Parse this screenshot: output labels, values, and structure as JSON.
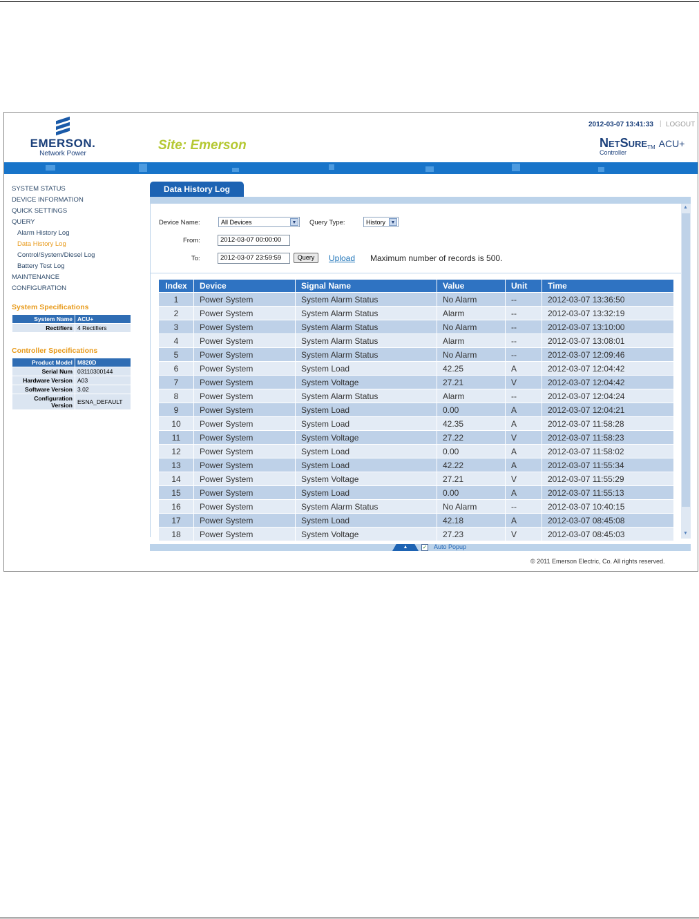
{
  "header": {
    "logo_name": "EMERSON.",
    "logo_sub": "Network Power",
    "site_title": "Site: Emerson",
    "datetime": "2012-03-07 13:41:33",
    "separator": "|",
    "logout": "LOGOUT",
    "brand_name": "NetSure",
    "brand_tm": "TM",
    "brand_product": "ACU+",
    "brand_sub": "Controller"
  },
  "nav": {
    "items": [
      {
        "label": "SYSTEM STATUS"
      },
      {
        "label": "DEVICE INFORMATION"
      },
      {
        "label": "QUICK SETTINGS"
      },
      {
        "label": "QUERY"
      },
      {
        "label": "Alarm History Log"
      },
      {
        "label": "Data History Log"
      },
      {
        "label": "Control/System/Diesel Log"
      },
      {
        "label": "Battery Test Log"
      },
      {
        "label": "MAINTENANCE"
      },
      {
        "label": "CONFIGURATION"
      }
    ]
  },
  "system_specs": {
    "title": "System Specifications",
    "rows": [
      {
        "key": "System Name",
        "value": "ACU+"
      },
      {
        "key": "Rectifiers",
        "value": "4 Rectifiers"
      }
    ]
  },
  "controller_specs": {
    "title": "Controller Specifications",
    "rows": [
      {
        "key": "Product Model",
        "value": "M820D"
      },
      {
        "key": "Serial Num",
        "value": "03110300144"
      },
      {
        "key": "Hardware Version",
        "value": "A03"
      },
      {
        "key": "Software Version",
        "value": "3.02"
      },
      {
        "key": "Configuration Version",
        "value": "ESNA_DEFAULT"
      }
    ]
  },
  "tab": {
    "label": "Data History Log"
  },
  "query": {
    "device_name_label": "Device Name:",
    "device_name_value": "All Devices",
    "query_type_label": "Query Type:",
    "query_type_value": "History",
    "from_label": "From:",
    "from_value": "2012-03-07 00:00:00",
    "to_label": "To:",
    "to_value": "2012-03-07 23:59:59",
    "query_button": "Query",
    "upload_link": "Upload",
    "max_records": "Maximum number of records is 500."
  },
  "table": {
    "headers": [
      "Index",
      "Device",
      "Signal Name",
      "Value",
      "Unit",
      "Time"
    ],
    "rows": [
      [
        "1",
        "Power System",
        "System Alarm Status",
        "No Alarm",
        "--",
        "2012-03-07 13:36:50"
      ],
      [
        "2",
        "Power System",
        "System Alarm Status",
        "Alarm",
        "--",
        "2012-03-07 13:32:19"
      ],
      [
        "3",
        "Power System",
        "System Alarm Status",
        "No Alarm",
        "--",
        "2012-03-07 13:10:00"
      ],
      [
        "4",
        "Power System",
        "System Alarm Status",
        "Alarm",
        "--",
        "2012-03-07 13:08:01"
      ],
      [
        "5",
        "Power System",
        "System Alarm Status",
        "No Alarm",
        "--",
        "2012-03-07 12:09:46"
      ],
      [
        "6",
        "Power System",
        "System Load",
        "42.25",
        "A",
        "2012-03-07 12:04:42"
      ],
      [
        "7",
        "Power System",
        "System Voltage",
        "27.21",
        "V",
        "2012-03-07 12:04:42"
      ],
      [
        "8",
        "Power System",
        "System Alarm Status",
        "Alarm",
        "--",
        "2012-03-07 12:04:24"
      ],
      [
        "9",
        "Power System",
        "System Load",
        "0.00",
        "A",
        "2012-03-07 12:04:21"
      ],
      [
        "10",
        "Power System",
        "System Load",
        "42.35",
        "A",
        "2012-03-07 11:58:28"
      ],
      [
        "11",
        "Power System",
        "System Voltage",
        "27.22",
        "V",
        "2012-03-07 11:58:23"
      ],
      [
        "12",
        "Power System",
        "System Load",
        "0.00",
        "A",
        "2012-03-07 11:58:02"
      ],
      [
        "13",
        "Power System",
        "System Load",
        "42.22",
        "A",
        "2012-03-07 11:55:34"
      ],
      [
        "14",
        "Power System",
        "System Voltage",
        "27.21",
        "V",
        "2012-03-07 11:55:29"
      ],
      [
        "15",
        "Power System",
        "System Load",
        "0.00",
        "A",
        "2012-03-07 11:55:13"
      ],
      [
        "16",
        "Power System",
        "System Alarm Status",
        "No Alarm",
        "--",
        "2012-03-07 10:40:15"
      ],
      [
        "17",
        "Power System",
        "System Load",
        "42.18",
        "A",
        "2012-03-07 08:45:08"
      ],
      [
        "18",
        "Power System",
        "System Voltage",
        "27.23",
        "V",
        "2012-03-07 08:45:03"
      ]
    ]
  },
  "footer": {
    "auto_popup_label": "Auto Popup",
    "auto_popup_checked": true,
    "copyright": "© 2011 Emerson Electric, Co. All rights reserved."
  },
  "colors": {
    "accent_blue": "#1d63b3",
    "site_title": "#b5c832",
    "active_nav": "#e89a1a",
    "row_odd": "#bed1e8",
    "row_even": "#e3ebf5"
  }
}
